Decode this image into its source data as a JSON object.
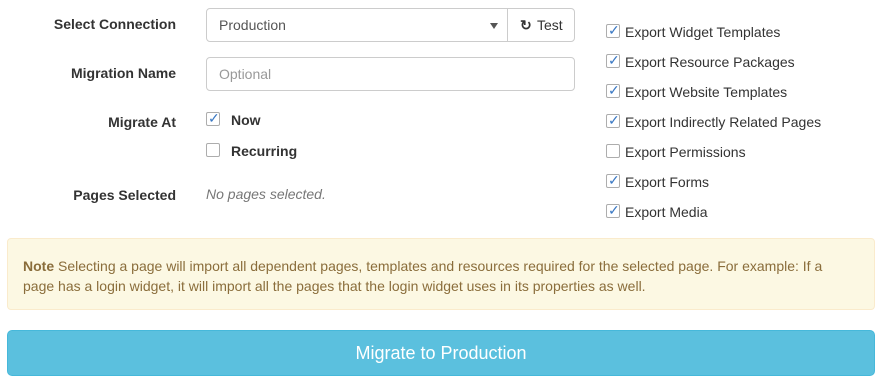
{
  "form": {
    "connection": {
      "label": "Select Connection",
      "value": "Production",
      "test_label": "Test",
      "test_icon": "refresh-icon"
    },
    "migration_name": {
      "label": "Migration Name",
      "placeholder": "Optional",
      "value": ""
    },
    "migrate_at": {
      "label": "Migrate At",
      "options": [
        {
          "label": "Now",
          "checked": true
        },
        {
          "label": "Recurring",
          "checked": false
        }
      ]
    },
    "pages_selected": {
      "label": "Pages Selected",
      "value": "No pages selected."
    }
  },
  "exports": [
    {
      "label": "Export Widget Templates",
      "checked": true
    },
    {
      "label": "Export Resource Packages",
      "checked": true
    },
    {
      "label": "Export Website Templates",
      "checked": true
    },
    {
      "label": "Export Indirectly Related Pages",
      "checked": true
    },
    {
      "label": "Export Permissions",
      "checked": false
    },
    {
      "label": "Export Forms",
      "checked": true
    },
    {
      "label": "Export Media",
      "checked": true
    }
  ],
  "note": {
    "title": "Note",
    "body": "Selecting a page will import all dependent pages, templates and resources required for the selected page. For example: If a page has a login widget, it will import all the pages that the login widget uses in its properties as well."
  },
  "submit": {
    "label": "Migrate to Production"
  },
  "colors": {
    "accent": "#5bc0de",
    "check": "#3a78c3",
    "note_bg": "#fcf8e3",
    "note_text": "#8a6d3b"
  }
}
